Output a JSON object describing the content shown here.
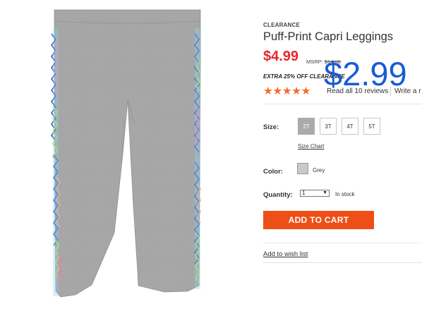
{
  "product": {
    "eyebrow": "CLEARANCE",
    "title": "Puff-Print Capri Leggings",
    "price": "$4.99",
    "msrp_label": "MSRP: ",
    "msrp_value": "$14.00",
    "promo": "EXTRA 25% OFF CLEARANCE",
    "rating_stars": "★★★★★",
    "reviews_link": "Read all 10 reviews",
    "write_review": "Write a r",
    "overlay_price": "$2.99",
    "image_icon": "gray-capri-leggings-with-puff-print-side-stripes"
  },
  "size": {
    "label": "Size:",
    "options": [
      "2T",
      "3T",
      "4T",
      "5T"
    ],
    "selected": "2T",
    "chart_link": "Size Chart"
  },
  "color": {
    "label": "Color:",
    "swatch": "#c9c9c9",
    "name": "Grey"
  },
  "quantity": {
    "label": "Quantity:",
    "value": "1",
    "stock": "In stock"
  },
  "actions": {
    "add_to_cart": "ADD TO CART",
    "wish_list": "Add to wish list"
  },
  "colors": {
    "price_red": "#e8262b",
    "star_orange": "#f26b2f",
    "cart_orange": "#ee4f17",
    "overlay_blue": "#1a5bd6"
  }
}
